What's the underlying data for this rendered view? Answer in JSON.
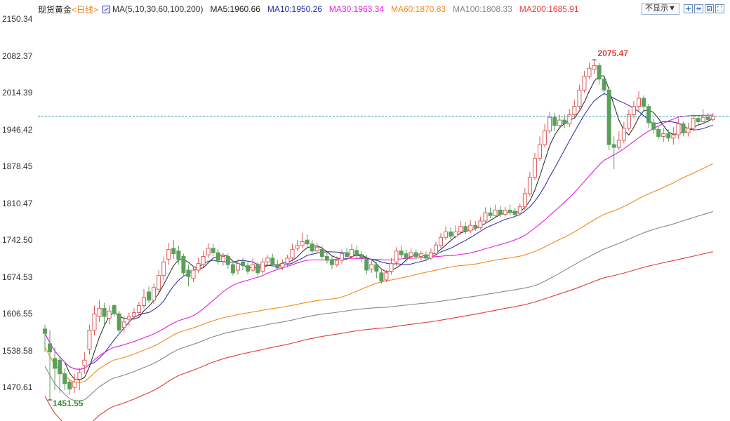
{
  "header": {
    "instrument": "现货黄金",
    "period": "<日线>",
    "ma_definition": "MA(5,10,30,60,100,200)",
    "ma_values": [
      {
        "label": "MA5:1960.66",
        "color": "#222222"
      },
      {
        "label": "MA10:1950.26",
        "color": "#2626a6"
      },
      {
        "label": "MA30:1963.34",
        "color": "#e020e0"
      },
      {
        "label": "MA60:1870.83",
        "color": "#f08a1c"
      },
      {
        "label": "MA100:1808.33",
        "color": "#888888"
      },
      {
        "label": "MA200:1685.91",
        "color": "#e03c3c"
      }
    ]
  },
  "controls": {
    "hide_label": "不显示▼",
    "icons": [
      "zoom-in-icon",
      "zoom-out-icon",
      "settings-icon",
      "fullscreen-icon"
    ]
  },
  "chart_data": {
    "type": "candlestick",
    "y_ticks": [
      "2150.34",
      "2082.37",
      "2014.39",
      "1946.42",
      "1878.45",
      "1810.47",
      "1742.50",
      "1674.53",
      "1606.55",
      "1538.58",
      "1470.61"
    ],
    "ylim": [
      1452.0,
      2150.34
    ],
    "high_label": "2075.47",
    "low_label": "1451.55",
    "current_price_line": 1972,
    "colors": {
      "up": "#e05a5a",
      "down": "#5aa05a"
    },
    "candles": [
      [
        1582,
        1574,
        1590,
        1540
      ],
      [
        1555,
        1540,
        1580,
        1452
      ],
      [
        1528,
        1510,
        1548,
        1470
      ],
      [
        1525,
        1500,
        1532,
        1465
      ],
      [
        1500,
        1482,
        1510,
        1470
      ],
      [
        1485,
        1472,
        1490,
        1462
      ],
      [
        1475,
        1485,
        1500,
        1465
      ],
      [
        1490,
        1502,
        1510,
        1470
      ],
      [
        1515,
        1525,
        1540,
        1500
      ],
      [
        1545,
        1580,
        1590,
        1535
      ],
      [
        1580,
        1610,
        1625,
        1570
      ],
      [
        1605,
        1620,
        1635,
        1595
      ],
      [
        1620,
        1605,
        1630,
        1590
      ],
      [
        1602,
        1615,
        1625,
        1590
      ],
      [
        1625,
        1610,
        1628,
        1605
      ],
      [
        1610,
        1580,
        1615,
        1572
      ],
      [
        1585,
        1595,
        1605,
        1575
      ],
      [
        1600,
        1605,
        1612,
        1588
      ],
      [
        1605,
        1612,
        1620,
        1598
      ],
      [
        1612,
        1625,
        1632,
        1608
      ],
      [
        1625,
        1640,
        1655,
        1620
      ],
      [
        1650,
        1635,
        1660,
        1630
      ],
      [
        1635,
        1658,
        1665,
        1628
      ],
      [
        1655,
        1680,
        1690,
        1648
      ],
      [
        1680,
        1705,
        1715,
        1672
      ],
      [
        1710,
        1728,
        1740,
        1700
      ],
      [
        1730,
        1720,
        1745,
        1710
      ],
      [
        1725,
        1710,
        1735,
        1700
      ],
      [
        1715,
        1685,
        1720,
        1678
      ],
      [
        1690,
        1678,
        1700,
        1660
      ],
      [
        1675,
        1690,
        1698,
        1668
      ],
      [
        1690,
        1702,
        1712,
        1685
      ],
      [
        1700,
        1715,
        1725,
        1695
      ],
      [
        1718,
        1730,
        1740,
        1712
      ],
      [
        1730,
        1722,
        1738,
        1715
      ],
      [
        1722,
        1708,
        1728,
        1700
      ],
      [
        1706,
        1715,
        1722,
        1698
      ],
      [
        1715,
        1700,
        1720,
        1692
      ],
      [
        1700,
        1685,
        1708,
        1680
      ],
      [
        1690,
        1702,
        1710,
        1682
      ],
      [
        1705,
        1698,
        1712,
        1690
      ],
      [
        1698,
        1688,
        1704,
        1682
      ],
      [
        1690,
        1700,
        1712,
        1686
      ],
      [
        1700,
        1685,
        1705,
        1680
      ],
      [
        1688,
        1705,
        1712,
        1682
      ],
      [
        1705,
        1712,
        1718,
        1698
      ],
      [
        1712,
        1702,
        1720,
        1698
      ],
      [
        1700,
        1694,
        1708,
        1690
      ],
      [
        1695,
        1702,
        1710,
        1690
      ],
      [
        1702,
        1712,
        1718,
        1695
      ],
      [
        1712,
        1728,
        1738,
        1706
      ],
      [
        1730,
        1735,
        1745,
        1725
      ],
      [
        1735,
        1742,
        1758,
        1730
      ],
      [
        1745,
        1738,
        1755,
        1730
      ],
      [
        1738,
        1725,
        1745,
        1720
      ],
      [
        1725,
        1732,
        1740,
        1720
      ],
      [
        1728,
        1715,
        1735,
        1710
      ],
      [
        1715,
        1708,
        1722,
        1702
      ],
      [
        1708,
        1700,
        1715,
        1692
      ],
      [
        1700,
        1708,
        1715,
        1695
      ],
      [
        1708,
        1720,
        1728,
        1702
      ],
      [
        1722,
        1715,
        1730,
        1708
      ],
      [
        1715,
        1728,
        1738,
        1710
      ],
      [
        1726,
        1718,
        1735,
        1712
      ],
      [
        1718,
        1712,
        1725,
        1705
      ],
      [
        1710,
        1690,
        1718,
        1682
      ],
      [
        1692,
        1700,
        1708,
        1685
      ],
      [
        1700,
        1688,
        1705,
        1675
      ],
      [
        1685,
        1670,
        1692,
        1665
      ],
      [
        1672,
        1685,
        1690,
        1668
      ],
      [
        1688,
        1702,
        1712,
        1682
      ],
      [
        1705,
        1725,
        1732,
        1698
      ],
      [
        1725,
        1718,
        1735,
        1712
      ],
      [
        1720,
        1712,
        1728,
        1705
      ],
      [
        1715,
        1722,
        1730,
        1710
      ],
      [
        1722,
        1715,
        1728,
        1710
      ],
      [
        1715,
        1720,
        1725,
        1708
      ],
      [
        1718,
        1712,
        1724,
        1706
      ],
      [
        1712,
        1722,
        1730,
        1708
      ],
      [
        1720,
        1736,
        1742,
        1715
      ],
      [
        1735,
        1750,
        1758,
        1730
      ],
      [
        1750,
        1760,
        1770,
        1745
      ],
      [
        1760,
        1752,
        1768,
        1746
      ],
      [
        1752,
        1760,
        1772,
        1748
      ],
      [
        1760,
        1770,
        1780,
        1755
      ],
      [
        1770,
        1762,
        1778,
        1756
      ],
      [
        1762,
        1772,
        1782,
        1758
      ],
      [
        1772,
        1768,
        1780,
        1762
      ],
      [
        1768,
        1780,
        1788,
        1764
      ],
      [
        1780,
        1795,
        1805,
        1775
      ],
      [
        1795,
        1790,
        1805,
        1785
      ],
      [
        1790,
        1800,
        1810,
        1785
      ],
      [
        1800,
        1792,
        1808,
        1786
      ],
      [
        1792,
        1800,
        1806,
        1788
      ],
      [
        1800,
        1796,
        1810,
        1790
      ],
      [
        1798,
        1792,
        1804,
        1786
      ],
      [
        1794,
        1806,
        1812,
        1790
      ],
      [
        1806,
        1830,
        1840,
        1800
      ],
      [
        1830,
        1860,
        1870,
        1825
      ],
      [
        1860,
        1895,
        1905,
        1855
      ],
      [
        1895,
        1920,
        1935,
        1890
      ],
      [
        1920,
        1945,
        1958,
        1915
      ],
      [
        1945,
        1970,
        1980,
        1940
      ],
      [
        1970,
        1955,
        1978,
        1945
      ],
      [
        1955,
        1965,
        1975,
        1948
      ],
      [
        1965,
        1958,
        1975,
        1950
      ],
      [
        1958,
        1975,
        1985,
        1952
      ],
      [
        1975,
        1990,
        2002,
        1970
      ],
      [
        1990,
        2020,
        2030,
        1985
      ],
      [
        2020,
        2045,
        2055,
        2015
      ],
      [
        2045,
        2060,
        2070,
        2040
      ],
      [
        2058,
        2065,
        2075.47,
        2050
      ],
      [
        2065,
        2040,
        2070,
        2030
      ],
      [
        2040,
        2020,
        2045,
        2010
      ],
      [
        2020,
        1920,
        2025,
        1910
      ],
      [
        1920,
        1915,
        1935,
        1875
      ],
      [
        1915,
        1928,
        1945,
        1910
      ],
      [
        1928,
        1950,
        1962,
        1922
      ],
      [
        1950,
        1975,
        1985,
        1945
      ],
      [
        1975,
        1990,
        2000,
        1968
      ],
      [
        1990,
        2005,
        2018,
        1982
      ],
      [
        2005,
        1990,
        2010,
        1980
      ],
      [
        1990,
        1960,
        1995,
        1950
      ],
      [
        1960,
        1948,
        1968,
        1940
      ],
      [
        1948,
        1935,
        1955,
        1930
      ],
      [
        1935,
        1940,
        1950,
        1925
      ],
      [
        1940,
        1932,
        1948,
        1925
      ],
      [
        1932,
        1938,
        1952,
        1920
      ],
      [
        1938,
        1958,
        1968,
        1930
      ],
      [
        1958,
        1942,
        1962,
        1935
      ],
      [
        1942,
        1950,
        1960,
        1935
      ],
      [
        1950,
        1968,
        1975,
        1945
      ],
      [
        1968,
        1962,
        1975,
        1955
      ],
      [
        1962,
        1970,
        1985,
        1958
      ],
      [
        1970,
        1966,
        1978,
        1960
      ],
      [
        1966,
        1972,
        1978,
        1962
      ]
    ]
  }
}
